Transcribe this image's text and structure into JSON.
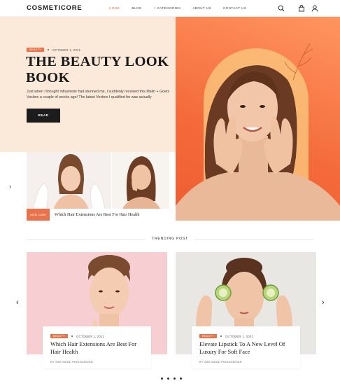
{
  "header": {
    "logo": "COSMETICORE",
    "nav": [
      {
        "label": "HOME"
      },
      {
        "label": "BLOG"
      },
      {
        "label": "+ CATEGORIES"
      },
      {
        "label": "ABOUT US"
      },
      {
        "label": "CONTACT US"
      }
    ],
    "icons": [
      "search-icon",
      "bag-icon",
      "user-icon"
    ]
  },
  "hero": {
    "tag": "BEAUTY",
    "date": "OCTOBER 1, 2021",
    "title": "THE BEAUTY LOOK BOOK",
    "description": "Just when I thought Influenster had stunned me, I suddenly received this Malin + Goetz Voxbox a couple of weeks ago! The latest Voxbox I qualified for was actually",
    "button": "READ"
  },
  "mini_slider": {
    "tag": "SKIN CARE",
    "title": "Which Hair Extensions Are Best For Hair Health"
  },
  "trending": {
    "heading": "TRENDING POST",
    "cards": [
      {
        "tag": "BEAUTY",
        "date": "OCTOBER 1, 2021",
        "title": "Which Hair Extensions Are Best For Hair Health",
        "author": "BY SAR MAAD PAHLAVANIAN"
      },
      {
        "tag": "BEAUTY",
        "date": "OCTOBER 1, 2021",
        "title": "Elevate Lipstick To A New Level Of Luxury For Soft Face",
        "author": "BY SAR MAAD PAHLAVANIAN"
      }
    ],
    "pager_count": 4
  },
  "colors": {
    "accent": "#e8734a",
    "hero_bg": "#fbe9da",
    "dark": "#1c1c1c"
  }
}
